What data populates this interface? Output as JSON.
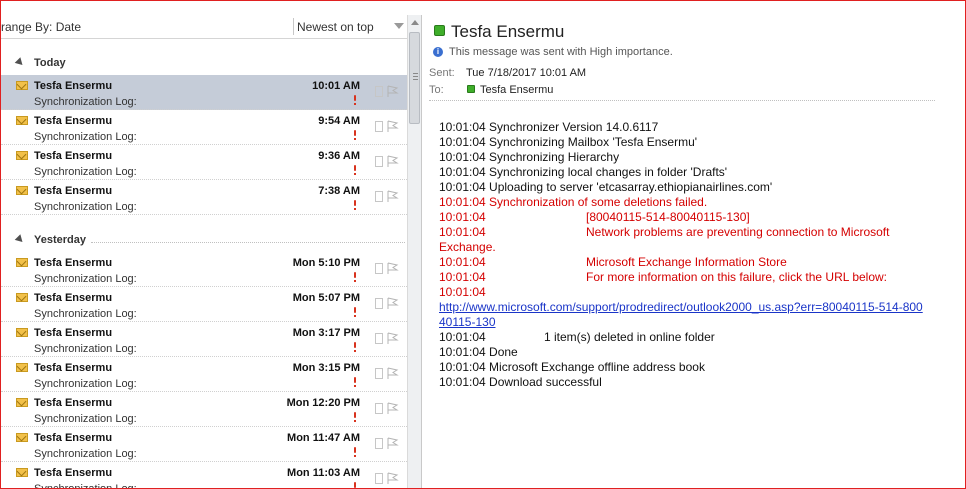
{
  "list_header": {
    "arrange_by": "rrange By: Date",
    "sort_order": "Newest on top"
  },
  "groups": {
    "today": "Today",
    "yesterday": "Yesterday"
  },
  "messages": [
    {
      "sender": "Tesfa Ensermu",
      "subject": "Synchronization Log:",
      "time": "10:01 AM",
      "selected": true
    },
    {
      "sender": "Tesfa Ensermu",
      "subject": "Synchronization Log:",
      "time": "9:54 AM"
    },
    {
      "sender": "Tesfa Ensermu",
      "subject": "Synchronization Log:",
      "time": "9:36 AM"
    },
    {
      "sender": "Tesfa Ensermu",
      "subject": "Synchronization Log:",
      "time": "7:38 AM"
    },
    {
      "sender": "Tesfa Ensermu",
      "subject": "Synchronization Log:",
      "time": "Mon 5:10 PM"
    },
    {
      "sender": "Tesfa Ensermu",
      "subject": "Synchronization Log:",
      "time": "Mon 5:07 PM"
    },
    {
      "sender": "Tesfa Ensermu",
      "subject": "Synchronization Log:",
      "time": "Mon 3:17 PM"
    },
    {
      "sender": "Tesfa Ensermu",
      "subject": "Synchronization Log:",
      "time": "Mon 3:15 PM"
    },
    {
      "sender": "Tesfa Ensermu",
      "subject": "Synchronization Log:",
      "time": "Mon 12:20 PM"
    },
    {
      "sender": "Tesfa Ensermu",
      "subject": "Synchronization Log:",
      "time": "Mon 11:47 AM"
    },
    {
      "sender": "Tesfa Ensermu",
      "subject": "Synchronization Log:",
      "time": "Mon 11:03 AM"
    }
  ],
  "reading": {
    "sender": "Tesfa Ensermu",
    "importance_note": "This message was sent with High importance.",
    "sent_label": "Sent:",
    "sent_value": "Tue 7/18/2017 10:01 AM",
    "to_label": "To:",
    "to_value": "Tesfa Ensermu",
    "body": {
      "l1": "10:01:04 Synchronizer Version 14.0.6117",
      "l2": "10:01:04 Synchronizing Mailbox 'Tesfa Ensermu'",
      "l3": "10:01:04 Synchronizing Hierarchy",
      "l4": "10:01:04 Synchronizing local changes in folder 'Drafts'",
      "l5": "10:01:04 Uploading to server 'etcasarray.ethiopianairlines.com'",
      "l6": "10:01:04 Synchronization of some deletions failed.",
      "e1_time": "10:01:04",
      "e1_text": "[80040115-514-80040115-130]",
      "e2_time": "10:01:04",
      "e2_text": "Network problems are preventing connection to Microsoft",
      "e2_cont": "Exchange.",
      "e3_time": "10:01:04",
      "e3_text": "Microsoft Exchange Information Store",
      "e4_time": "10:01:04",
      "e4_text": "For more information on this failure, click the URL below:",
      "e5_time": "10:01:04",
      "url": "http://www.microsoft.com/support/prodredirect/outlook2000_us.asp?err=80040115-514-80040115-130",
      "d_time": "10:01:04",
      "d_text": "1 item(s) deleted in online folder",
      "l7": "10:01:04 Done",
      "l8": "10:01:04 Microsoft Exchange offline address book",
      "l9": "10:01:04 Download successful"
    }
  },
  "colors": {
    "selected_row": "#c5ccd8",
    "error_text": "#d40000",
    "link": "#1a35c8",
    "presence_online": "#3fae2a"
  }
}
